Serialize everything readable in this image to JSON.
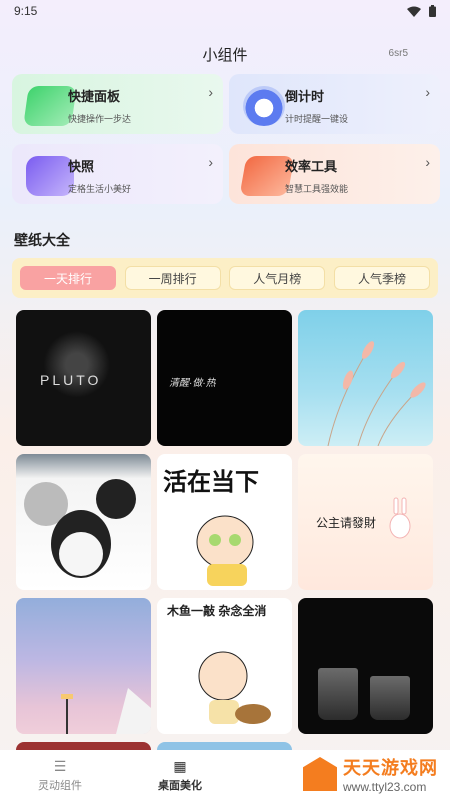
{
  "status_bar": {
    "time": "9:15",
    "wifi_icon": "wifi-icon",
    "battery_icon": "battery-icon"
  },
  "header": {
    "title": "小组件",
    "code": "6sr5"
  },
  "widgets": [
    {
      "title": "快捷面板",
      "subtitle": "快捷操作一步达",
      "icon": "panel-icon",
      "accent": "#3fd36d"
    },
    {
      "title": "倒计时",
      "subtitle": "计时提醒一键设",
      "icon": "clock-icon",
      "accent": "#5c7bf0"
    },
    {
      "title": "快照",
      "subtitle": "定格生活小美好",
      "icon": "camera-icon",
      "accent": "#7a5cf0"
    },
    {
      "title": "效率工具",
      "subtitle": "智慧工具强效能",
      "icon": "toolbox-icon",
      "accent": "#f26a43"
    }
  ],
  "wallpaper_section": {
    "title": "壁纸大全"
  },
  "tabs": [
    {
      "label": "一天排行",
      "active": true
    },
    {
      "label": "一周排行",
      "active": false
    },
    {
      "label": "人气月榜",
      "active": false
    },
    {
      "label": "人气季榜",
      "active": false
    }
  ],
  "wallpapers": [
    {
      "text": "PLUTO"
    },
    {
      "text": "清醒·做·热"
    },
    {
      "text": ""
    },
    {
      "text": ""
    },
    {
      "text": "活在当下"
    },
    {
      "text": "公主请發財"
    },
    {
      "text": ""
    },
    {
      "text": "木鱼一敲 杂念全消"
    },
    {
      "text": ""
    }
  ],
  "bottom_nav": [
    {
      "label": "灵动组件",
      "icon": "widget-nav-icon",
      "active": false
    },
    {
      "label": "桌面美化",
      "icon": "grid-nav-icon",
      "active": true
    }
  ],
  "watermark": {
    "name": "天天游戏网",
    "url": "www.ttyl23.com"
  },
  "colors": {
    "tab_active": "#f9a2a2",
    "tabs_bg": "#fcefc6",
    "watermark": "#f47d1f"
  }
}
